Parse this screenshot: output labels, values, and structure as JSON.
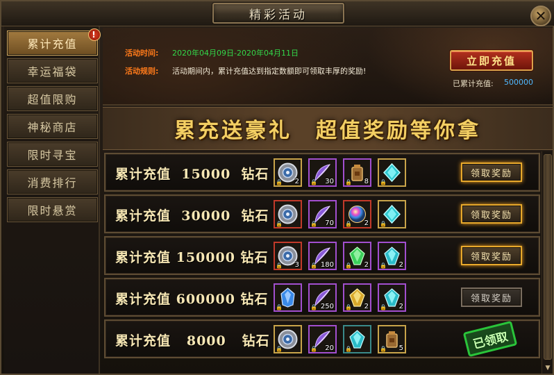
{
  "window": {
    "title": "精彩活动",
    "close_glyph": "✕"
  },
  "sidebar": {
    "items": [
      {
        "label": "累计充值",
        "active": true
      },
      {
        "label": "幸运福袋",
        "active": false
      },
      {
        "label": "超值限购",
        "active": false
      },
      {
        "label": "神秘商店",
        "active": false
      },
      {
        "label": "限时寻宝",
        "active": false
      },
      {
        "label": "消费排行",
        "active": false
      },
      {
        "label": "限时悬赏",
        "active": false
      }
    ],
    "alert_badge": "!"
  },
  "info": {
    "time_label": "活动时间:",
    "time_value": "2020年04月09日-2020年04月11日",
    "rule_label": "活动规则:",
    "rule_value": "活动期间内，累计充值达到指定数额即可领取丰厚的奖励!",
    "recharge_button": "立即充值",
    "accum_label": "已累计充值:",
    "accum_value": "500000"
  },
  "banner": {
    "text": "累充送豪礼　超值奖励等你拿"
  },
  "rewards": [
    {
      "label": "累计充值  15000  钻石",
      "items": [
        {
          "icon": "medal-icon",
          "quality": "gold",
          "qty": "2"
        },
        {
          "icon": "feather-icon",
          "quality": "purple",
          "qty": "30"
        },
        {
          "icon": "bag-icon",
          "quality": "purple",
          "qty": "8"
        },
        {
          "icon": "teal-gem-icon",
          "quality": "gold",
          "qty": ""
        }
      ],
      "action": "领取奖励",
      "state": "claimable"
    },
    {
      "label": "累计充值  30000  钻石",
      "items": [
        {
          "icon": "medal-icon",
          "quality": "red",
          "qty": ""
        },
        {
          "icon": "feather-icon",
          "quality": "purple",
          "qty": "70"
        },
        {
          "icon": "rainbow-orb-icon",
          "quality": "red",
          "qty": "2"
        },
        {
          "icon": "teal-gem-icon",
          "quality": "gold",
          "qty": ""
        }
      ],
      "action": "领取奖励",
      "state": "claimable"
    },
    {
      "label": "累计充值 150000 钻石",
      "items": [
        {
          "icon": "medal-icon",
          "quality": "red",
          "qty": "3"
        },
        {
          "icon": "feather-icon",
          "quality": "purple",
          "qty": "180"
        },
        {
          "icon": "green-crystal-icon",
          "quality": "purple",
          "qty": "2"
        },
        {
          "icon": "teal-crystal-icon",
          "quality": "purple",
          "qty": "2"
        }
      ],
      "action": "领取奖励",
      "state": "claimable"
    },
    {
      "label": "累计充值 600000 钻石",
      "items": [
        {
          "icon": "blue-crystal-icon",
          "quality": "purple",
          "qty": ""
        },
        {
          "icon": "feather-icon",
          "quality": "purple",
          "qty": "250"
        },
        {
          "icon": "gold-crystal-icon",
          "quality": "purple",
          "qty": "2"
        },
        {
          "icon": "teal-crystal-icon",
          "quality": "purple",
          "qty": "2"
        }
      ],
      "action": "领取奖励",
      "state": "locked"
    },
    {
      "label": "累计充值   8000   钻石",
      "items": [
        {
          "icon": "medal-icon",
          "quality": "gold",
          "qty": ""
        },
        {
          "icon": "feather-icon",
          "quality": "purple",
          "qty": "20"
        },
        {
          "icon": "teal-crystal-icon",
          "quality": "teal",
          "qty": ""
        },
        {
          "icon": "bag-icon",
          "quality": "gold",
          "qty": "5"
        }
      ],
      "action": "已领取",
      "state": "claimed"
    }
  ],
  "scroll": {
    "arrow": "▼"
  }
}
